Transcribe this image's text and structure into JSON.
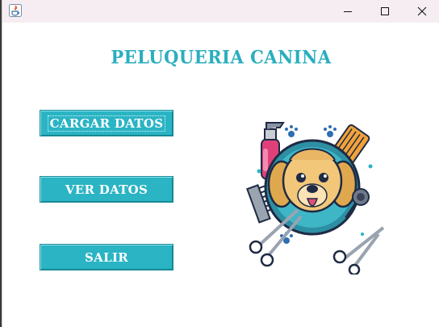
{
  "window": {
    "colors": {
      "titlebar": "#f6edf2",
      "accent": "#2ab4c4",
      "title_text": "#2aaebe",
      "button_text": "#ffffff"
    },
    "controls": {
      "minimize_icon": "minimize-icon",
      "maximize_icon": "maximize-icon",
      "close_icon": "close-icon"
    }
  },
  "app": {
    "title": "PELUQUERIA CANINA"
  },
  "buttons": {
    "cargar": "CARGAR DATOS",
    "ver": "VER DATOS",
    "salir": "SALIR"
  },
  "illustration": {
    "icon": "dog-grooming-logo"
  }
}
